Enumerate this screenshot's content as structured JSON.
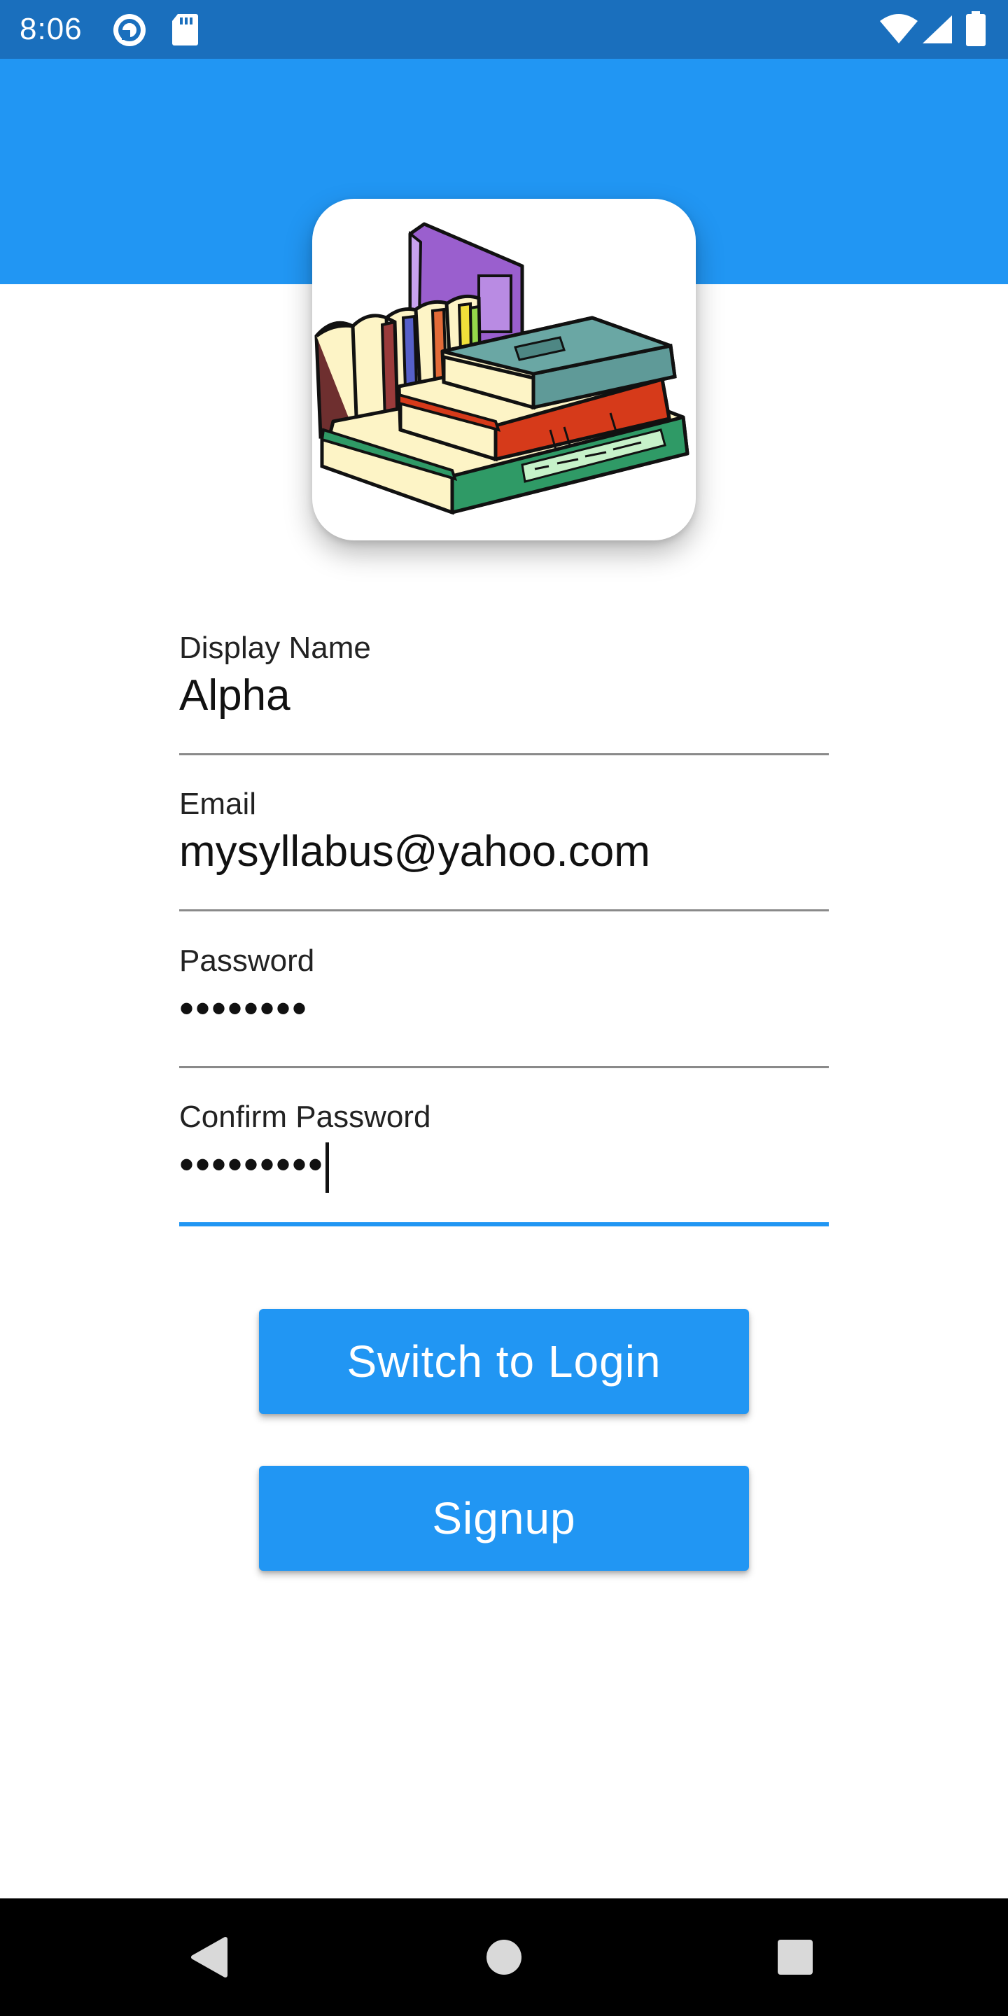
{
  "status_bar": {
    "time": "8:06",
    "icons": [
      "pocket-casts-icon",
      "sd-card-icon",
      "wifi-icon",
      "cellular-signal-icon",
      "battery-icon"
    ]
  },
  "colors": {
    "primary": "#2196f3",
    "status_bar": "#1a6fbd",
    "underline": "#8a8a8a"
  },
  "logo": {
    "icon": "stack-of-books-icon"
  },
  "form": {
    "display_name": {
      "label": "Display Name",
      "value": "Alpha"
    },
    "email": {
      "label": "Email",
      "value": "mysyllabus@yahoo.com"
    },
    "password": {
      "label": "Password",
      "value": "••••••••"
    },
    "confirm_password": {
      "label": "Confirm Password",
      "value": "•••••••••"
    }
  },
  "buttons": {
    "switch_label": "Switch to Login",
    "signup_label": "Signup"
  },
  "nav_bar": {
    "icons": [
      "back-icon",
      "home-icon",
      "recents-icon"
    ]
  }
}
